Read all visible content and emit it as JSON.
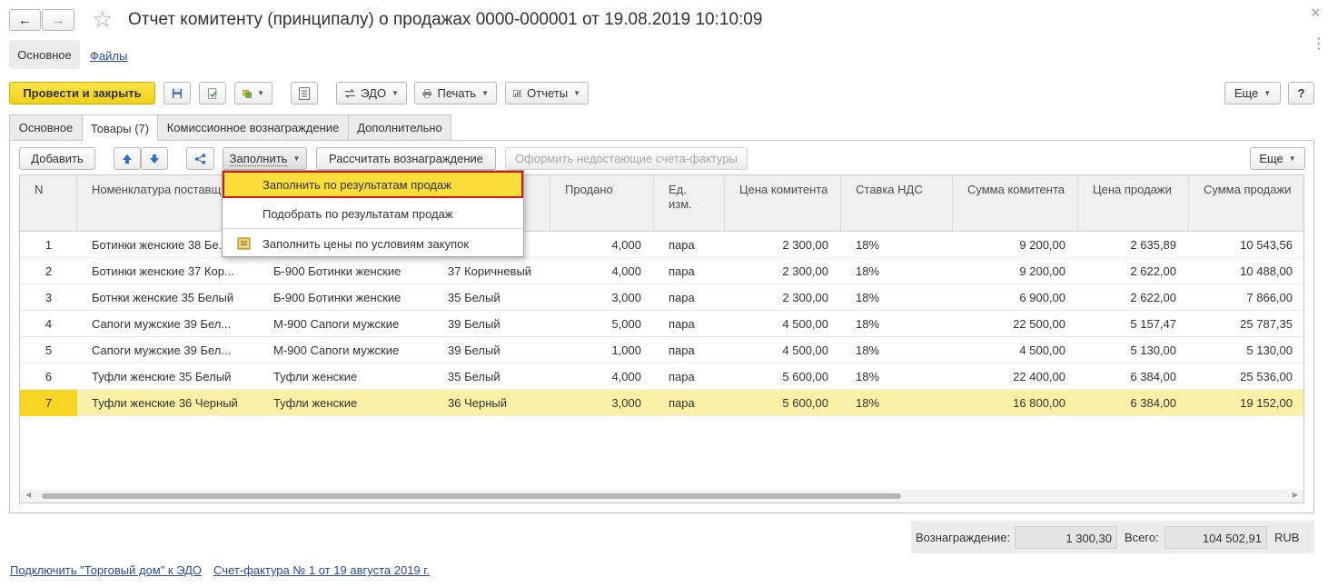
{
  "window": {
    "title": "Отчет комитенту (принципалу) о продажах 0000-000001 от 19.08.2019 10:10:09",
    "close_glyph": "×",
    "more_glyph": "⋮"
  },
  "nav": {
    "back": "←",
    "forward": "→",
    "star": "☆"
  },
  "form_tabs": {
    "main": "Основное",
    "files": "Файлы"
  },
  "toolbar": {
    "post_close": "Провести и закрыть",
    "edo": "ЭДО",
    "print": "Печать",
    "reports": "Отчеты",
    "more": "Еще",
    "help": "?"
  },
  "tabs": [
    "Основное",
    "Товары (7)",
    "Комиссионное вознаграждение",
    "Дополнительно"
  ],
  "table_toolbar": {
    "add": "Добавить",
    "fill": "Заполнить",
    "calc": "Рассчитать вознаграждение",
    "invoices": "Оформить недостающие счета-фактуры",
    "more": "Еще"
  },
  "fill_menu": {
    "item1": "Заполнить по результатам продаж",
    "item2": "Подобрать по результатам продаж",
    "item3": "Заполнить цены по условиям закупок"
  },
  "columns": {
    "n": "N",
    "nom": "Номенклатура поставщика",
    "sold": "Продано",
    "unit": "Ед. изм.",
    "price_c": "Цена комитента",
    "vat": "Ставка НДС",
    "sum_c": "Сумма комитента",
    "price_s": "Цена продажи",
    "sum_s": "Сумма продажи"
  },
  "rows": [
    {
      "n": "1",
      "nom": "Ботинки женские 38 Бе...",
      "nom2": "",
      "char": "",
      "sold": "4,000",
      "unit": "пара",
      "price_c": "2 300,00",
      "vat": "18%",
      "sum_c": "9 200,00",
      "price_s": "2 635,89",
      "sum_s": "10 543,56"
    },
    {
      "n": "2",
      "nom": "Ботинки женские 37 Кор...",
      "nom2": "Б-900 Ботинки женские",
      "char": "37 Коричневый",
      "sold": "4,000",
      "unit": "пара",
      "price_c": "2 300,00",
      "vat": "18%",
      "sum_c": "9 200,00",
      "price_s": "2 622,00",
      "sum_s": "10 488,00"
    },
    {
      "n": "3",
      "nom": "Ботнки женские 35 Белый",
      "nom2": "Б-900 Ботинки женские",
      "char": "35 Белый",
      "sold": "3,000",
      "unit": "пара",
      "price_c": "2 300,00",
      "vat": "18%",
      "sum_c": "6 900,00",
      "price_s": "2 622,00",
      "sum_s": "7 866,00"
    },
    {
      "n": "4",
      "nom": "Сапоги мужские 39 Бел...",
      "nom2": "М-900 Сапоги мужские",
      "char": "39 Белый",
      "sold": "5,000",
      "unit": "пара",
      "price_c": "4 500,00",
      "vat": "18%",
      "sum_c": "22 500,00",
      "price_s": "5 157,47",
      "sum_s": "25 787,35"
    },
    {
      "n": "5",
      "nom": "Сапоги мужские 39 Бел...",
      "nom2": "М-900 Сапоги мужские",
      "char": "39 Белый",
      "sold": "1,000",
      "unit": "пара",
      "price_c": "4 500,00",
      "vat": "18%",
      "sum_c": "4 500,00",
      "price_s": "5 130,00",
      "sum_s": "5 130,00"
    },
    {
      "n": "6",
      "nom": "Туфли женские 35 Белый",
      "nom2": "Туфли женские",
      "char": "35 Белый",
      "sold": "4,000",
      "unit": "пара",
      "price_c": "5 600,00",
      "vat": "18%",
      "sum_c": "22 400,00",
      "price_s": "6 384,00",
      "sum_s": "25 536,00"
    },
    {
      "n": "7",
      "nom": "Туфли женские 36 Черный",
      "nom2": "Туфли женские",
      "char": "36 Черный",
      "sold": "3,000",
      "unit": "пара",
      "price_c": "5 600,00",
      "vat": "18%",
      "sum_c": "16 800,00",
      "price_s": "6 384,00",
      "sum_s": "19 152,00"
    }
  ],
  "totals": {
    "reward_label": "Вознаграждение:",
    "reward_value": "1 300,30",
    "total_label": "Всего:",
    "total_value": "104 502,91",
    "currency": "RUB"
  },
  "footer": {
    "edo_link": "Подключить \"Торговый дом\" к ЭДО",
    "invoice_link": "Счет-фактура № 1 от 19 августа 2019 г."
  },
  "colors": {
    "accent": "#f4cf14",
    "selected_row": "#faf1a6",
    "highlight_border": "#d3181b"
  }
}
